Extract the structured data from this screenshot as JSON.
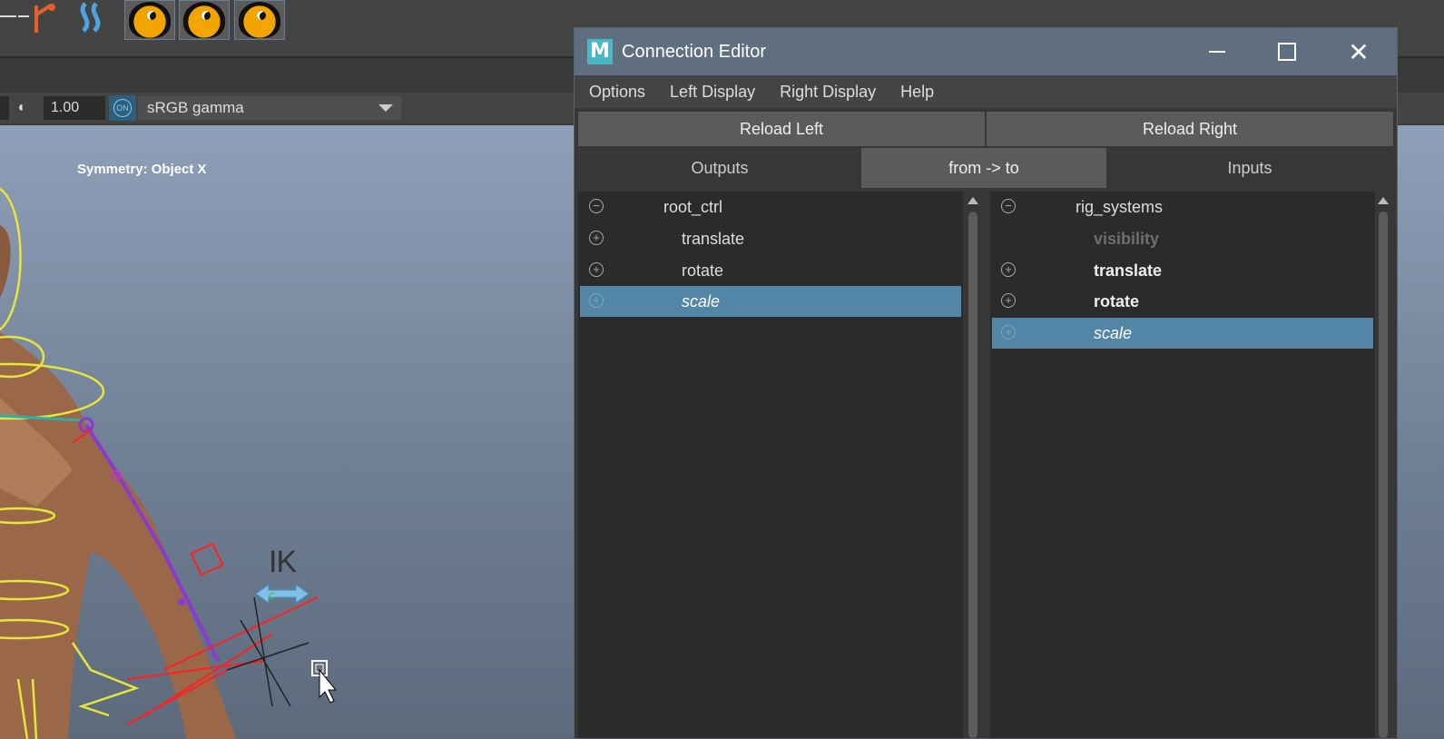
{
  "viewport": {
    "gamma_value": "1.00",
    "gamma_toggle": "ON",
    "color_space": "sRGB gamma",
    "symmetry_label": "Symmetry: Object X",
    "ik_label": "IK"
  },
  "window": {
    "title": "Connection Editor",
    "logo": "M",
    "menu": [
      "Options",
      "Left Display",
      "Right Display",
      "Help"
    ],
    "reload_left": "Reload Left",
    "reload_right": "Reload Right",
    "modes": {
      "outputs": "Outputs",
      "from_to": "from -> to",
      "inputs": "Inputs"
    },
    "left_list": {
      "node": "root_ctrl",
      "attributes": [
        "translate",
        "rotate",
        "scale"
      ],
      "selected": "scale"
    },
    "right_list": {
      "node": "rig_systems",
      "attributes": [
        "visibility",
        "translate",
        "rotate",
        "scale"
      ],
      "selected": "scale"
    }
  },
  "colors": {
    "selection": "#5285a6",
    "title_bar": "#5f6f80",
    "rig_yellow": "#e6e63a",
    "rig_red": "#ff2020",
    "rig_purple": "#8a3ad0"
  }
}
